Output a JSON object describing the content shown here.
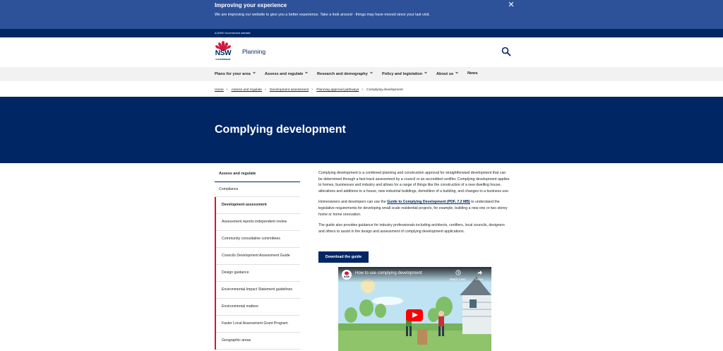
{
  "notice": {
    "title": "Improving your experience",
    "message": "We are improving our website to give you a better experience. Take a look around - things may have moved since your last visit.",
    "close_glyph": "✕"
  },
  "masthead": {
    "label": "A NSW Government website"
  },
  "header": {
    "logo_text": "NSW",
    "logo_subtext": "GOVERNMENT",
    "site_name": "Planning",
    "search_icon": "search-icon"
  },
  "nav": {
    "items": [
      {
        "label": "Plans for your area",
        "has_menu": true
      },
      {
        "label": "Assess and regulate",
        "has_menu": true
      },
      {
        "label": "Research and demography",
        "has_menu": true
      },
      {
        "label": "Policy and legislation",
        "has_menu": true
      },
      {
        "label": "About us",
        "has_menu": true
      },
      {
        "label": "News",
        "has_menu": false
      }
    ]
  },
  "breadcrumb": {
    "items": [
      "Home",
      "Assess and regulate",
      "Development assessment",
      "Planning approval pathways"
    ],
    "current": "Complying development"
  },
  "hero": {
    "title": "Complying development"
  },
  "sidenav": {
    "heading": "Assess and regulate",
    "items": [
      "Compliance",
      "Development assessment"
    ],
    "subitems": [
      "Assessment reports independent review",
      "Community consultative committees",
      "Councils Development Assessment Guide",
      "Design guidance",
      "Environmental Impact Statement guidelines",
      "Environmental matters",
      "Faster Local Assessment Grant Program",
      "Geographic areas"
    ]
  },
  "content": {
    "para1": "Complying development is a combined planning and construction approval for straightforward development that can be determined through a fast-track assessment by a council or an accredited certifier. Complying development applies to homes, businesses and industry and allows for a range of things like the construction of a new dwelling house, alterations and additions to a house, new industrial buildings, demolition of a building, and changes to a business use.",
    "para2_before": "Homeowners and developers can use the ",
    "para2_link": "Guide to Complying Development (PDF, 7.2 MB)",
    "para2_after": " to understand the legislative requirements for developing small scale residential projects, for example, building a new one or two storey home or home renovation.",
    "para3": "The guide also provides guidance for industry professionals including architects, certifiers, local councils, designers and others to assist in the design and assessment of complying development applications.",
    "download_label": "Download the guide"
  },
  "video": {
    "title": "How to use complying development",
    "channel": "NSW",
    "watch_later": "Watch Later",
    "share": "Share"
  },
  "colors": {
    "navy": "#002664",
    "notice_blue": "#2e5299",
    "red": "#d7153a"
  }
}
